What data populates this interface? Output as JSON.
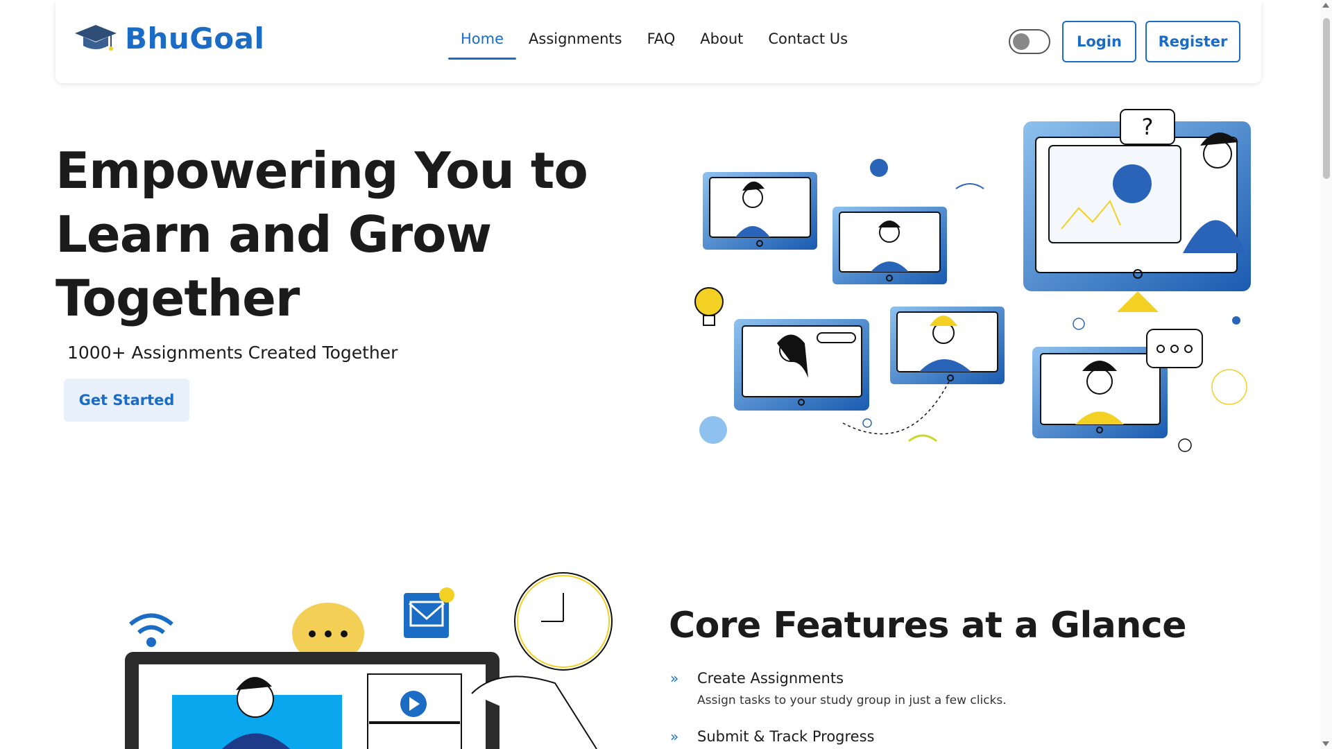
{
  "brand": {
    "name": "BhuGoal",
    "logo_icon": "graduation-cap-icon",
    "color": "#1a6cc4"
  },
  "nav": {
    "items": [
      {
        "label": "Home",
        "active": true
      },
      {
        "label": "Assignments",
        "active": false
      },
      {
        "label": "FAQ",
        "active": false
      },
      {
        "label": "About",
        "active": false
      },
      {
        "label": "Contact Us",
        "active": false
      }
    ]
  },
  "header": {
    "theme_toggle": "off",
    "login_label": "Login",
    "register_label": "Register"
  },
  "hero": {
    "title": "Empowering You to Learn and Grow Together",
    "subtitle": "1000+ Assignments Created Together",
    "cta_label": "Get Started"
  },
  "features": {
    "title": "Core Features at a Glance",
    "items": [
      {
        "title": "Create Assignments",
        "description": "Assign tasks to your study group in just a few clicks."
      },
      {
        "title": "Submit & Track Progress",
        "description": ""
      }
    ]
  },
  "colors": {
    "primary": "#1a6cc4",
    "accent_yellow": "#f2d024",
    "text": "#1b1b1b"
  }
}
